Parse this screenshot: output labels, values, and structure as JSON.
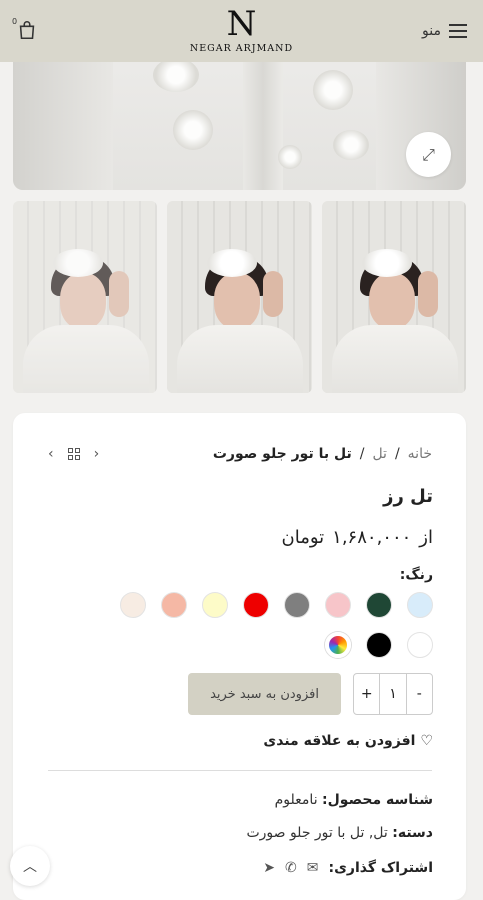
{
  "header": {
    "menu_label": "منو",
    "logo_mark": "N",
    "logo_text": "NEGAR ARJMAND",
    "cart_count": "0"
  },
  "icons": {
    "cart": "shopping-bag-icon",
    "menu": "hamburger-icon",
    "zoom": "expand-icon",
    "wishlist": "heart-icon",
    "scroll_top": "chevron-up-icon"
  },
  "breadcrumb": {
    "home": "خانه",
    "separator": "/",
    "category": "تل",
    "current": "تل با تور جلو صورت"
  },
  "product": {
    "title": "تل رز",
    "price_prefix": "از",
    "price": "۱,۶۸۰,۰۰۰",
    "currency": "تومان",
    "color_label": "رنگ:",
    "colors": [
      "#d8ecfa",
      "#1f4735",
      "#f7c5c9",
      "#7f7f7f",
      "#ee0000",
      "#fdfbc8",
      "#f5b8a5",
      "#f7ece3",
      "#ffffff",
      "#000000",
      "multicolor"
    ]
  },
  "cart_form": {
    "minus": "-",
    "quantity": "۱",
    "plus": "+",
    "add_to_cart": "افزودن به سبد خرید"
  },
  "wishlist_label": "افزودن به علاقه مندی",
  "meta": {
    "sku_label": "شناسه محصول:",
    "sku_value": "نامعلوم",
    "category_label": "دسته:",
    "category_value": "تل, تل با تور جلو صورت",
    "share_label": "اشتراک گذاری:"
  }
}
